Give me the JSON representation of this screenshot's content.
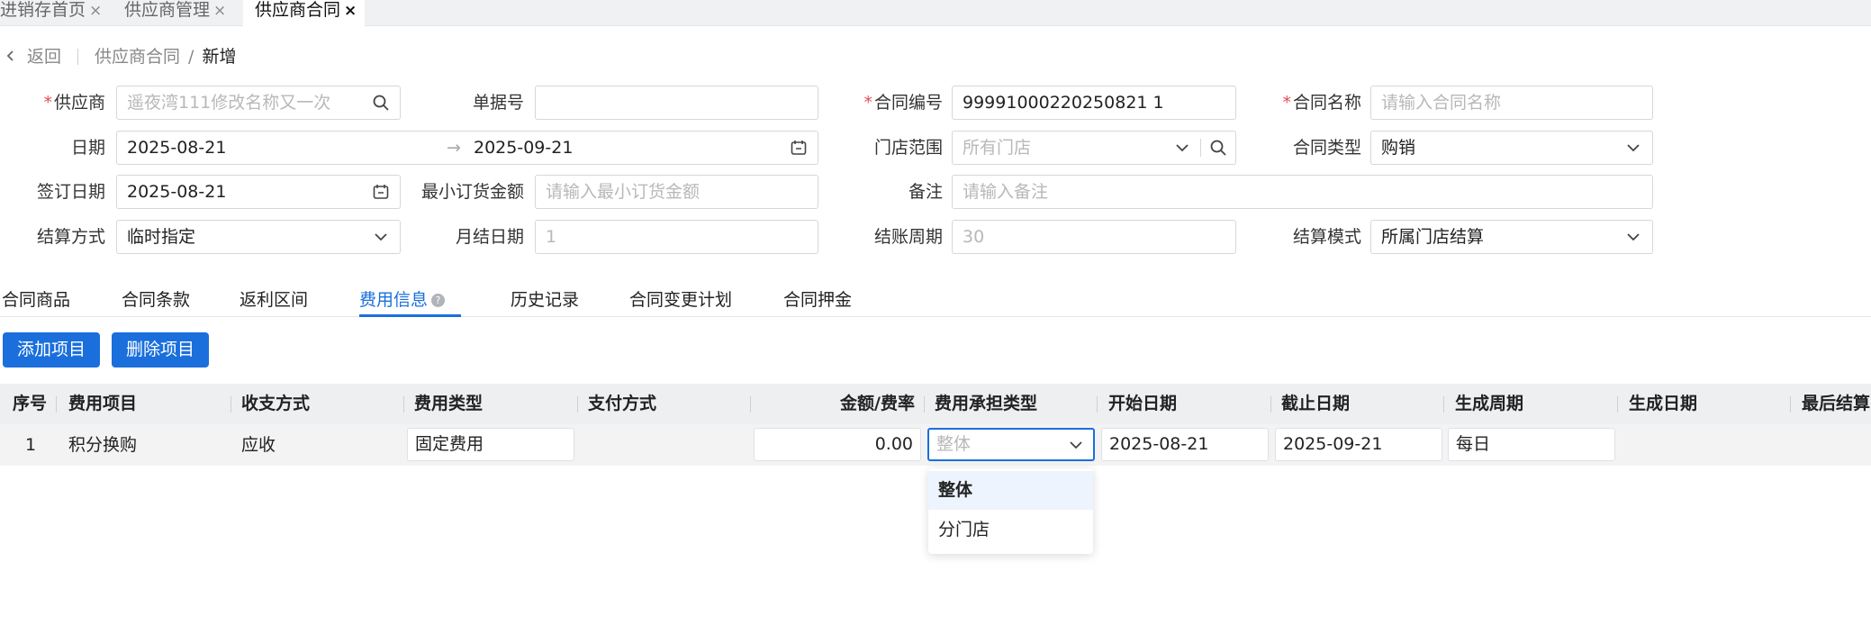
{
  "page_tabs": [
    {
      "label": "进销存首页",
      "close": "×"
    },
    {
      "label": "供应商管理",
      "close": "×"
    },
    {
      "label": "供应商合同",
      "close": "×"
    }
  ],
  "breadcrumb": {
    "back": "返回",
    "parent": "供应商合同",
    "sep": "/",
    "current": "新增"
  },
  "form": {
    "supplier": {
      "label": "供应商",
      "required": "*",
      "placeholder": "遥夜湾111修改名称又一次"
    },
    "doc_no": {
      "label": "单据号",
      "value": ""
    },
    "contract_no": {
      "label": "合同编号",
      "required": "*",
      "value": "99991000220250821 1"
    },
    "contract_name": {
      "label": "合同名称",
      "required": "*",
      "placeholder": "请输入合同名称"
    },
    "date": {
      "label": "日期",
      "start": "2025-08-21",
      "arrow": "→",
      "end": "2025-09-21"
    },
    "store_scope": {
      "label": "门店范围",
      "placeholder": "所有门店"
    },
    "contract_type": {
      "label": "合同类型",
      "value": "购销"
    },
    "sign_date": {
      "label": "签订日期",
      "value": "2025-08-21"
    },
    "min_order": {
      "label": "最小订货金额",
      "placeholder": "请输入最小订货金额"
    },
    "remark": {
      "label": "备注",
      "placeholder": "请输入备注"
    },
    "settle_method": {
      "label": "结算方式",
      "value": "临时指定"
    },
    "monthly_date": {
      "label": "月结日期",
      "value": "1"
    },
    "settle_cycle": {
      "label": "结账周期",
      "value": "30"
    },
    "settle_mode": {
      "label": "结算模式",
      "value": "所属门店结算"
    }
  },
  "section_tabs": [
    "合同商品",
    "合同条款",
    "返利区间",
    "费用信息",
    "历史记录",
    "合同变更计划",
    "合同押金"
  ],
  "active_section_tab": "费用信息",
  "buttons": {
    "add": "添加项目",
    "delete": "删除项目"
  },
  "table": {
    "headers": [
      "序号",
      "费用项目",
      "收支方式",
      "费用类型",
      "支付方式",
      "金额/费率",
      "费用承担类型",
      "开始日期",
      "截止日期",
      "生成周期",
      "生成日期",
      "最后结算"
    ],
    "rows": [
      {
        "index": "1",
        "item": "积分换购",
        "direction": "应收",
        "fee_type": "固定费用",
        "pay_method": "",
        "amount": "0.00",
        "bearing_type": "整体",
        "start": "2025-08-21",
        "end": "2025-09-21",
        "cycle": "每日",
        "gen_date": "",
        "last_settle": ""
      }
    ]
  },
  "dropdown": {
    "options": [
      "整体",
      "分门店"
    ],
    "selected": "整体"
  }
}
